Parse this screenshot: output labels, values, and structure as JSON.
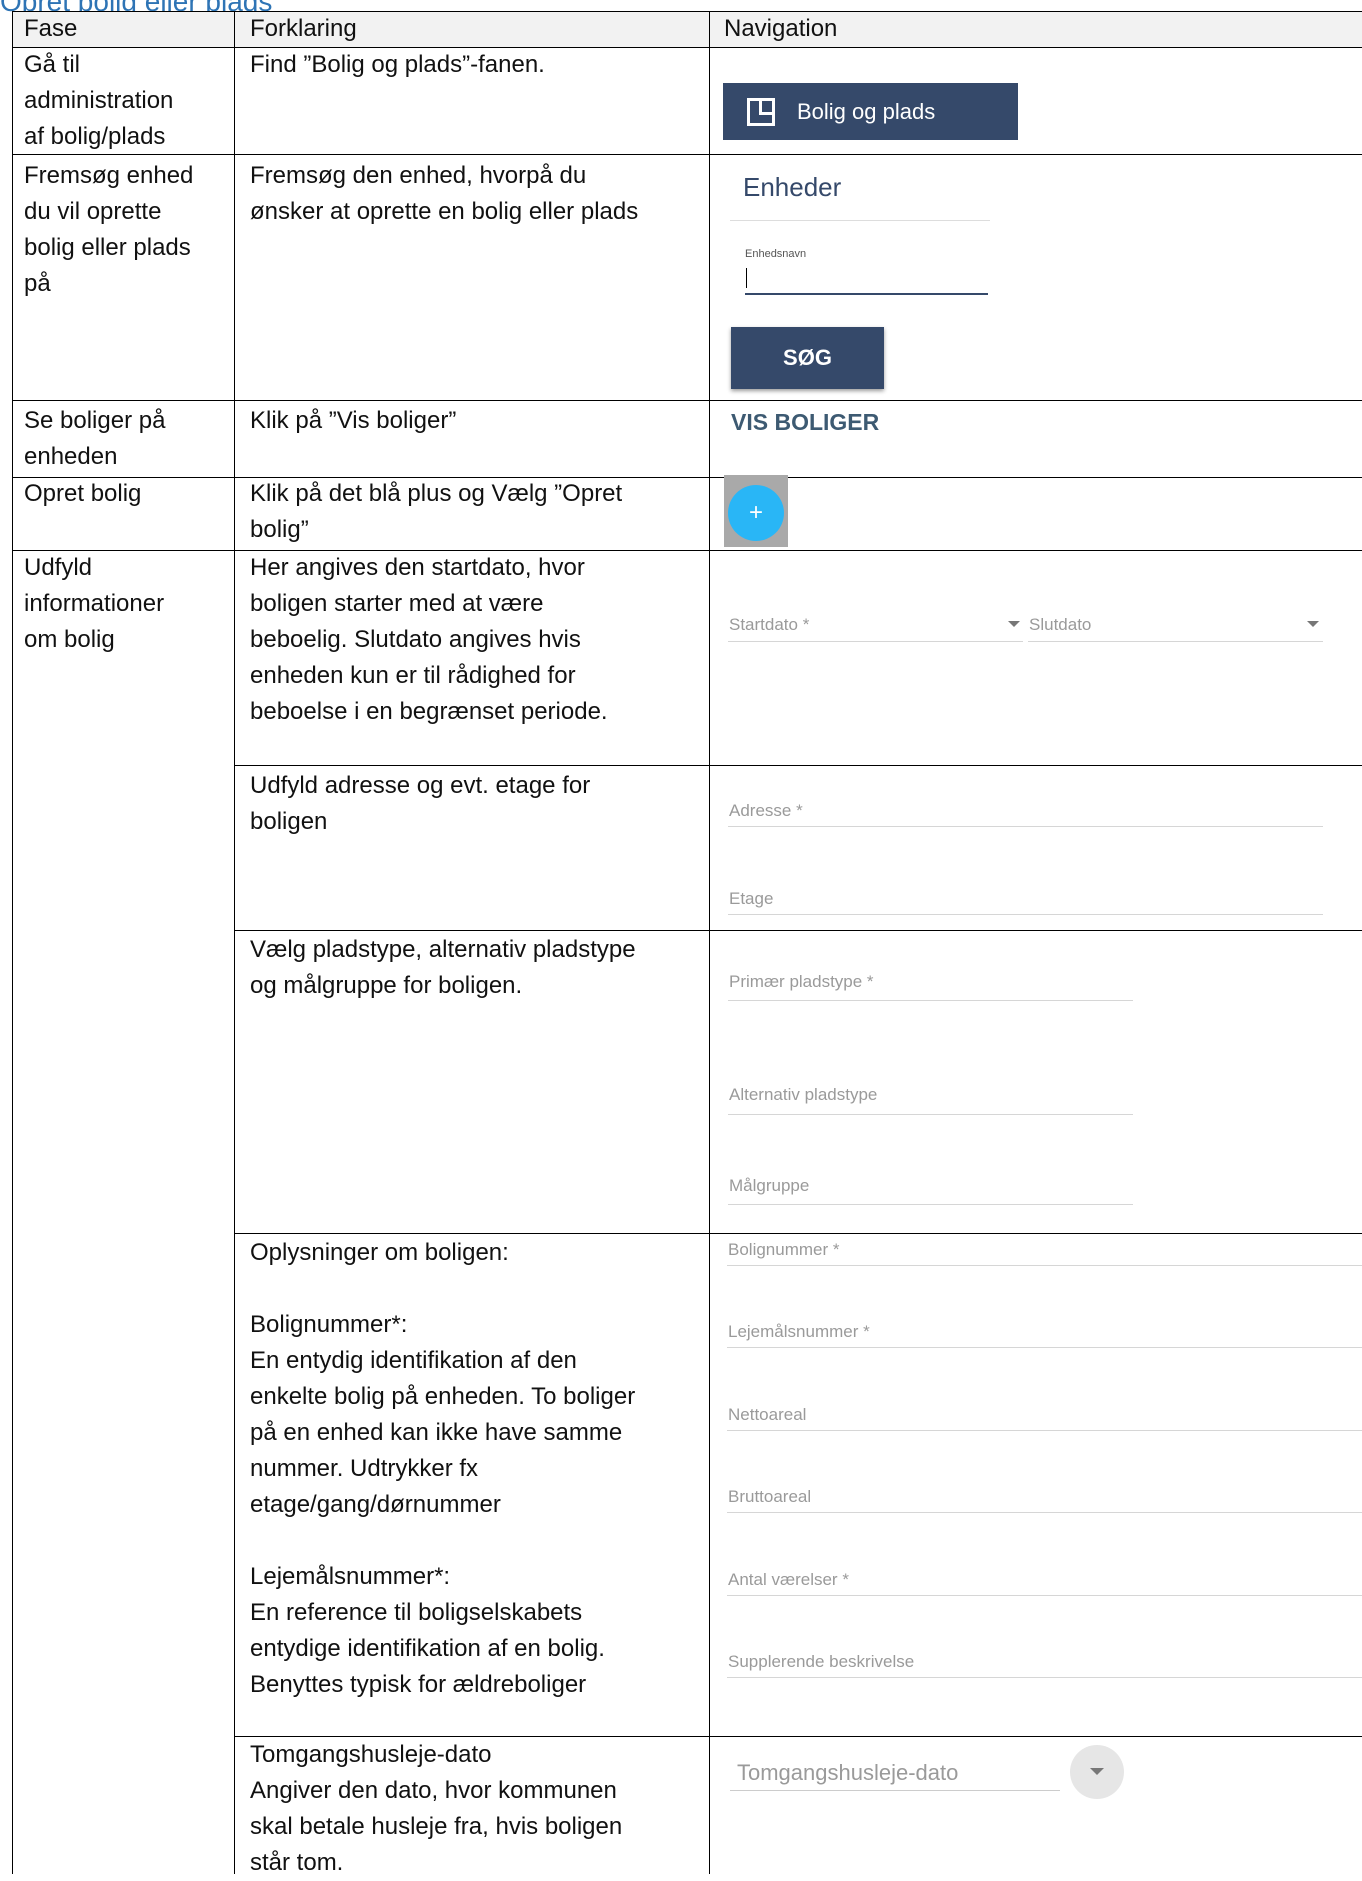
{
  "heading": "Opret bolig eller plads",
  "headers": {
    "fase": "Fase",
    "forklaring": "Forklaring",
    "navigation": "Navigation"
  },
  "rows": [
    {
      "fase": "Gå til\nadministration\naf bolig/plads",
      "forklaring": "Find ”Bolig og plads”-fanen."
    },
    {
      "fase": "Fremsøg enhed\ndu vil oprette\nbolig eller plads\npå",
      "forklaring": "Fremsøg den enhed, hvorpå du\nønsker at oprette en bolig eller plads"
    },
    {
      "fase": "Se boliger på\nenheden",
      "forklaring": "Klik på ”Vis boliger”"
    },
    {
      "fase": "Opret bolig",
      "forklaring": "Klik på det blå plus og Vælg ”Opret\nbolig”"
    },
    {
      "fase": "Udfyld\ninformationer\nom bolig",
      "forklaring": "Her angives den startdato, hvor\nboligen starter med at være\nbeboelig. Slutdato angives hvis\nenheden kun er til rådighed for\nbeboelse i en begrænset periode."
    },
    {
      "forklaring": "Udfyld adresse og evt. etage for\nboligen"
    },
    {
      "forklaring": "Vælg pladstype, alternativ pladstype\nog målgruppe for boligen."
    },
    {
      "forklaring": "Oplysninger om boligen:\n\nBolignummer*:\nEn entydig identifikation af den\nenkelte bolig på enheden. To boliger\npå en enhed kan ikke have samme\nnummer. Udtrykker fx\netage/gang/dørnummer\n\nLejemålsnummer*:\nEn reference til boligselskabets\nentydige identifikation af en bolig.\nBenyttes typisk for ældreboliger"
    },
    {
      "forklaring": "Tomgangshusleje-dato\nAngiver den dato, hvor kommunen\nskal betale husleje fra, hvis boligen\nstår tom."
    }
  ],
  "nav": {
    "bolig_og_plads": "Bolig og plads",
    "enheder_title": "Enheder",
    "enhedsnavn_label": "Enhedsnavn",
    "sog_button": "SØG",
    "vis_boliger": "VIS BOLIGER",
    "plus": "+",
    "startdato": "Startdato *",
    "slutdato": "Slutdato",
    "adresse": "Adresse *",
    "etage": "Etage",
    "primaer_pladstype": "Primær pladstype *",
    "alternativ_pladstype": "Alternativ pladstype",
    "malgruppe": "Målgruppe",
    "bolignummer": "Bolignummer *",
    "lejemalsnummer": "Lejemålsnummer *",
    "nettoareal": "Nettoareal",
    "bruttoareal": "Bruttoareal",
    "antal_vaerelser": "Antal værelser *",
    "supplerende_beskrivelse": "Supplerende beskrivelse",
    "tomgangshusleje_dato": "Tomgangshusleje-dato"
  }
}
